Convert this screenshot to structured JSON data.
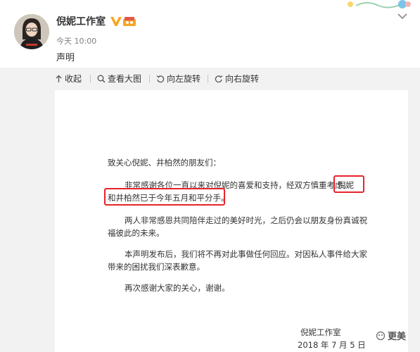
{
  "post": {
    "username": "倪妮工作室",
    "timestamp": "今天 10:00",
    "text": "声明"
  },
  "toolbar": {
    "collapse_label": "收起",
    "view_large_label": "查看大图",
    "rotate_left_label": "向左旋转",
    "rotate_right_label": "向右旋转"
  },
  "statement": {
    "greeting": "致关心倪妮、井柏然的朋友们：",
    "para1_line1": "非常感谢各位一直以来对倪妮的喜爱和支持，经双方慎重考虑，",
    "para1_highlight_a": "倪妮",
    "para1_line2": "和井柏然已于今年五月和平分手。",
    "para2_line1": "两人非常感恩共同陪伴走过的美好时光，之后仍会以朋友身份真诚祝",
    "para2_line2": "福彼此的未来。",
    "para3_line1": "本声明发布后，我们将不再对此事做任何回应。对因私人事件给大家",
    "para3_line2": "带来的困扰我们深表歉意。",
    "para4": "再次感谢大家的关心，谢谢。",
    "signature": "倪妮工作室",
    "date": "2018 年 7 月 5 日"
  },
  "watermark": {
    "text": "更美"
  },
  "colors": {
    "highlight_border": "#e8232b",
    "verified_badge": "#f6a623",
    "toolbar_bg": "#f2f2f2"
  },
  "icons": [
    "verified-v-icon",
    "vip-badge-icon",
    "chevron-down-icon",
    "collapse-up-icon",
    "magnify-icon",
    "rotate-left-icon",
    "rotate-right-icon",
    "watermark-logo-icon"
  ]
}
